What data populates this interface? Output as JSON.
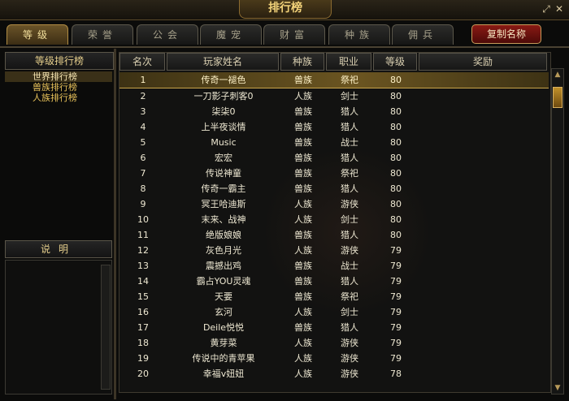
{
  "window": {
    "title": "排行榜",
    "close_symbol": "✕",
    "resize_symbol": "⤢"
  },
  "tabs": [
    {
      "label": "等级",
      "active": true
    },
    {
      "label": "荣誉",
      "active": false
    },
    {
      "label": "公会",
      "active": false
    },
    {
      "label": "魔宠",
      "active": false
    },
    {
      "label": "财富",
      "active": false
    },
    {
      "label": "种族",
      "active": false
    },
    {
      "label": "佣兵",
      "active": false
    }
  ],
  "copy_name_button": "复制名称",
  "left_panel": {
    "header": "等级排行榜",
    "items": [
      "世界排行榜",
      "兽族排行榜",
      "人族排行榜"
    ],
    "selected_index": 0,
    "description_header": "说明"
  },
  "table": {
    "columns": [
      "名次",
      "玩家姓名",
      "种族",
      "职业",
      "等级",
      "奖励"
    ],
    "selected_row": 0,
    "rows": [
      [
        "1",
        "传奇一褪色",
        "兽族",
        "祭祀",
        "80",
        ""
      ],
      [
        "2",
        "一刀影子刺客0",
        "人族",
        "剑士",
        "80",
        ""
      ],
      [
        "3",
        "柒柒0",
        "兽族",
        "猎人",
        "80",
        ""
      ],
      [
        "4",
        "上半夜谈情",
        "兽族",
        "猎人",
        "80",
        ""
      ],
      [
        "5",
        "Music",
        "兽族",
        "战士",
        "80",
        ""
      ],
      [
        "6",
        "宏宏",
        "兽族",
        "猎人",
        "80",
        ""
      ],
      [
        "7",
        "传说神童",
        "兽族",
        "祭祀",
        "80",
        ""
      ],
      [
        "8",
        "传奇一霸主",
        "兽族",
        "猎人",
        "80",
        ""
      ],
      [
        "9",
        "冥王哈迪斯",
        "人族",
        "游侠",
        "80",
        ""
      ],
      [
        "10",
        "末来、战神",
        "人族",
        "剑士",
        "80",
        ""
      ],
      [
        "11",
        "绝版娘娘",
        "兽族",
        "猎人",
        "80",
        ""
      ],
      [
        "12",
        "灰色月光",
        "人族",
        "游侠",
        "79",
        ""
      ],
      [
        "13",
        "震撼出鸡",
        "兽族",
        "战士",
        "79",
        ""
      ],
      [
        "14",
        "霸占YOU灵魂",
        "兽族",
        "猎人",
        "79",
        ""
      ],
      [
        "15",
        "天要",
        "兽族",
        "祭祀",
        "79",
        ""
      ],
      [
        "16",
        "玄河",
        "人族",
        "剑士",
        "79",
        ""
      ],
      [
        "17",
        "Deile悦悦",
        "兽族",
        "猎人",
        "79",
        ""
      ],
      [
        "18",
        "黄芽菜",
        "人族",
        "游侠",
        "79",
        ""
      ],
      [
        "19",
        "传说中的青苹果",
        "人族",
        "游侠",
        "79",
        ""
      ],
      [
        "20",
        "幸福v妞妞",
        "人族",
        "游侠",
        "78",
        ""
      ]
    ]
  },
  "colors": {
    "accent": "#f3d37a",
    "selected_row": "#6b5521",
    "copy_button": "#8a1a14"
  },
  "icons": {
    "scroll_up": "▲",
    "scroll_down": "▼"
  }
}
